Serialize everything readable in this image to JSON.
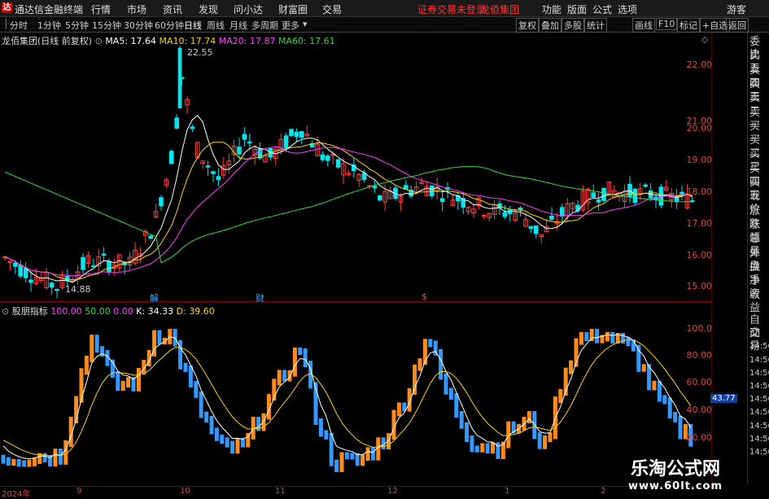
{
  "menu": {
    "app_title": "通达信金融终端",
    "items": [
      "行情",
      "市场",
      "资讯",
      "发现",
      "问小达",
      "财富圈",
      "交易"
    ],
    "warning": "证券交易未登录",
    "stock_link": "龙佰集团",
    "right_items": [
      "功能",
      "版面",
      "公式",
      "选项"
    ],
    "guest": "游客"
  },
  "toolbar": {
    "periods": [
      "分时",
      "1分钟",
      "5分钟",
      "15分钟",
      "30分钟",
      "60分钟",
      "日线",
      "周线",
      "月线",
      "多周期",
      "更多"
    ],
    "active_period": "日线",
    "buttons": [
      "复权",
      "叠加",
      "多股",
      "统计",
      "画线",
      "F10",
      "标记",
      "+自选",
      "返回"
    ]
  },
  "main": {
    "stock_title": "龙佰集团(日线 前复权)",
    "ma": [
      {
        "label": "MA5: 17.64",
        "color": "#ffffff"
      },
      {
        "label": "MA10: 17.74",
        "color": "#ffd400"
      },
      {
        "label": "MA20: 17.87",
        "color": "#ff3cff"
      },
      {
        "label": "MA60: 17.61",
        "color": "#33dd33"
      }
    ],
    "high_label": "22.55",
    "low_label": "14.88",
    "events": [
      "解",
      "财",
      "$"
    ],
    "price_ticks": [
      "22.00",
      "21.00",
      "20.00",
      "19.00",
      "18.00",
      "17.00",
      "16.00",
      "15.00"
    ]
  },
  "indicator": {
    "name": "股朋指标",
    "values": [
      {
        "label": "100.00",
        "color": "#ff3cff"
      },
      {
        "label": "50.00",
        "color": "#33dd33"
      },
      {
        "label": "0.00",
        "color": "#ff3cff"
      },
      {
        "label": "K: 34.33",
        "color": "#ffffff"
      },
      {
        "label": "D: 39.60",
        "color": "#ffd400"
      }
    ],
    "ticks": [
      "100.0",
      "80.00",
      "60.00",
      "40.00",
      "20.00"
    ],
    "current_value": "43.77"
  },
  "xaxis": {
    "labels": [
      "2024年",
      "9",
      "10",
      "11",
      "12",
      "1",
      "2"
    ]
  },
  "sidebar": {
    "top_items": [
      "委比",
      "卖五",
      "卖四",
      "卖三",
      "卖二",
      "卖一",
      "买一",
      "买二",
      "买三",
      "买四",
      "买五",
      "现价",
      "涨跌",
      "涨幅",
      "总量",
      "外盘",
      "换手",
      "净资",
      "收益"
    ],
    "bottom_items": [
      "自动",
      "交易",
      "14:56",
      "14:56",
      "14:56",
      "14:56",
      "14:56",
      "14:56",
      "14:56",
      "14:56",
      "14:56"
    ]
  },
  "watermark": {
    "title": "乐淘公式网",
    "url": "www.60lt.com"
  },
  "colors": {
    "up": "#ff4040",
    "down": "#00e5ee",
    "bar_up": "#ff8c1a",
    "bar_down": "#3399ff",
    "scale": "#e04040"
  }
}
